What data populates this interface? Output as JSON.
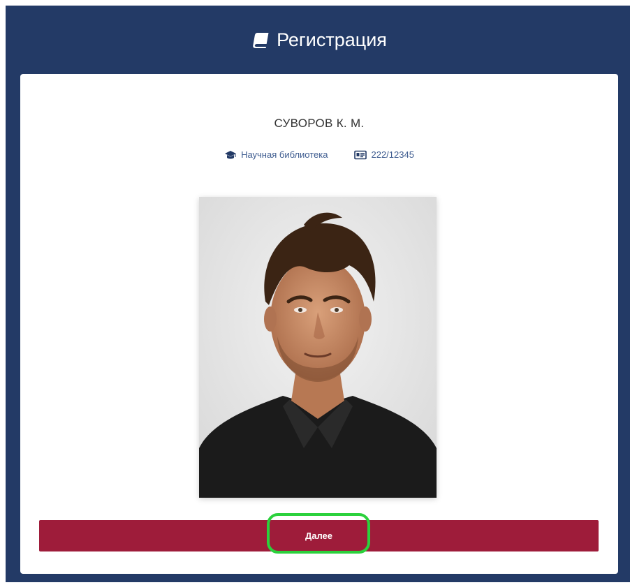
{
  "header": {
    "title": "Регистрация",
    "icon": "book-icon"
  },
  "user": {
    "name": "СУВОРОВ К. М.",
    "department": "Научная библиотека",
    "department_icon": "graduation-cap-icon",
    "card_number": "222/12345",
    "card_icon": "id-card-icon",
    "photo": "portrait-photo"
  },
  "actions": {
    "next_label": "Далее"
  },
  "colors": {
    "header_bg": "#233a66",
    "button_bg": "#9e1c3a",
    "highlight": "#2bd13c",
    "meta_text": "#3d5b8f"
  }
}
